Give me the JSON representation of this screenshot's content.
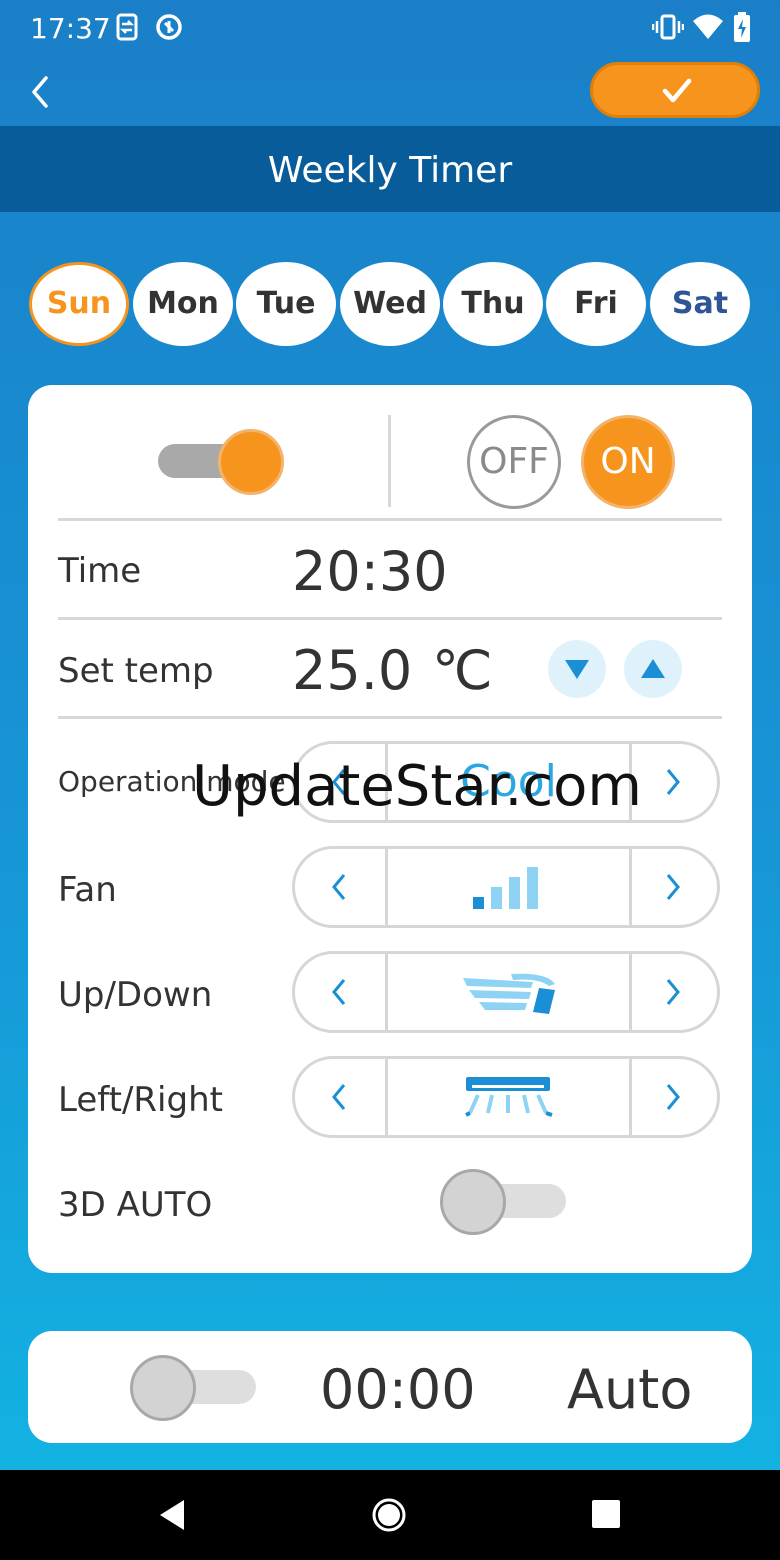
{
  "status_bar": {
    "time": "17:37",
    "icons": [
      "sync-icon",
      "data-saver-icon",
      "vibrate-icon",
      "wifi-icon",
      "battery-charging-icon"
    ]
  },
  "header": {
    "back_icon": "chevron-left-icon",
    "confirm_icon": "checkmark-icon",
    "title": "Weekly Timer"
  },
  "days": [
    {
      "label": "Sun",
      "selected": true
    },
    {
      "label": "Mon",
      "selected": false
    },
    {
      "label": "Tue",
      "selected": false
    },
    {
      "label": "Wed",
      "selected": false
    },
    {
      "label": "Thu",
      "selected": false
    },
    {
      "label": "Fri",
      "selected": false
    },
    {
      "label": "Sat",
      "selected": false
    }
  ],
  "timer_card": {
    "enabled": true,
    "off_label": "OFF",
    "on_label": "ON",
    "power_selected": "ON",
    "time_label": "Time",
    "time_value": "20:30",
    "temp_label": "Set temp",
    "temp_value": "25.0",
    "temp_unit": "℃",
    "mode_label": "Operation mode",
    "mode_value": "Cool",
    "fan_label": "Fan",
    "fan_icon": "fan-speed-bars-icon",
    "updown_label": "Up/Down",
    "updown_icon": "vertical-airflow-icon",
    "leftright_label": "Left/Right",
    "leftright_icon": "horizontal-airflow-icon",
    "auto3d_label": "3D AUTO",
    "auto3d_enabled": false
  },
  "second_timer": {
    "enabled": false,
    "time": "00:00",
    "mode": "Auto"
  },
  "watermark": "UpdateStar.com",
  "colors": {
    "accent": "#f7941d",
    "title_bar": "#095c9a",
    "icon_blue": "#1a8fd6",
    "light_blue": "#8fd3f4",
    "nav_bar": "#000000"
  }
}
